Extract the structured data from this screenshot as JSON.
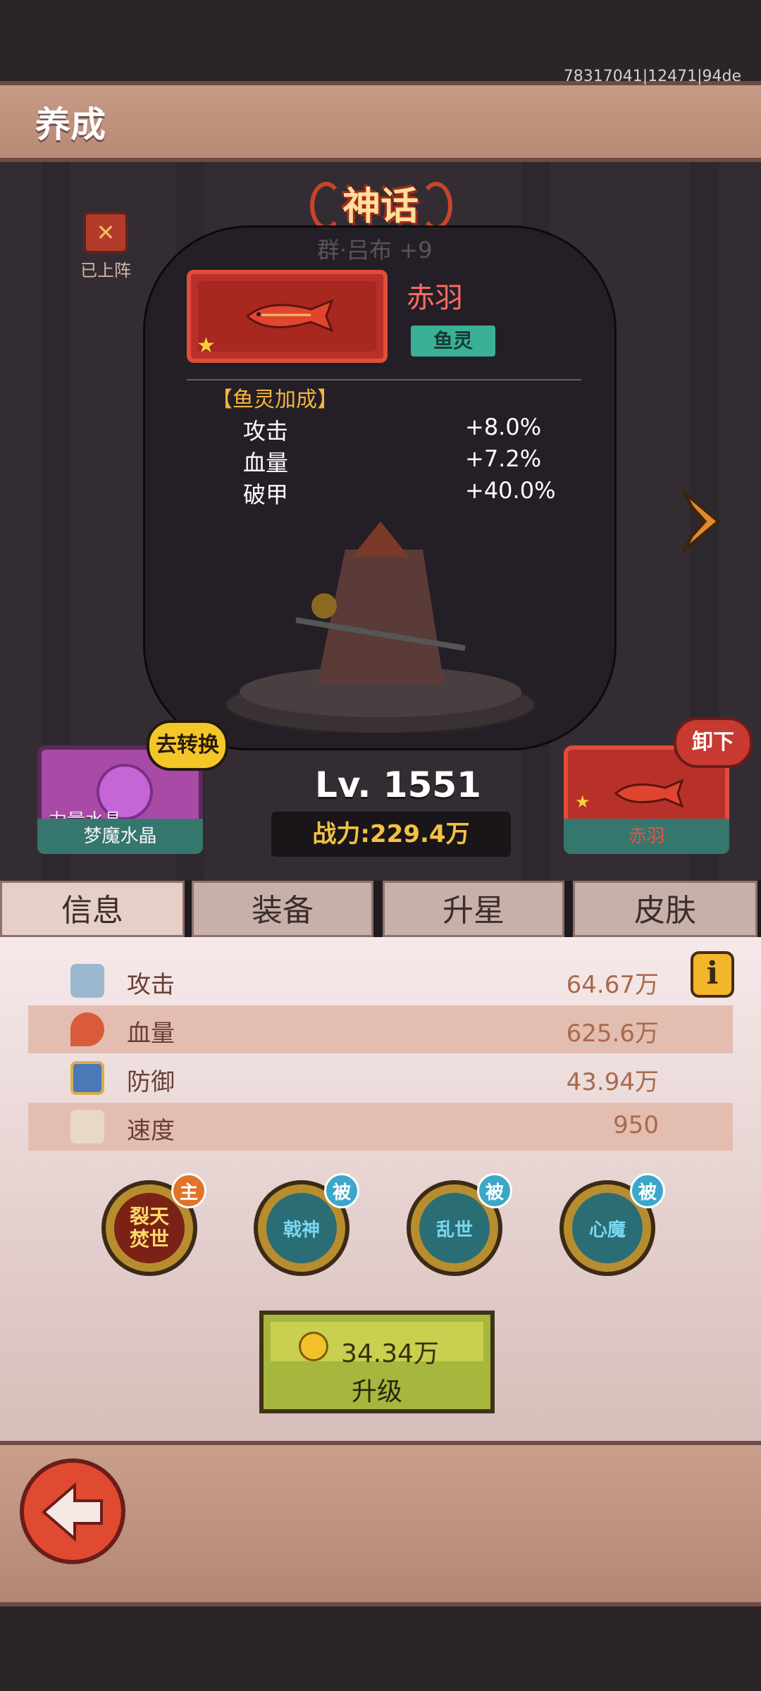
{
  "header": {
    "title": "养成",
    "build_id": "78317041|12471|94de"
  },
  "deploy": {
    "label": "已上阵",
    "icon": "crossed-swords-icon"
  },
  "hero": {
    "rarity": "神话",
    "name": "群·吕布 +9",
    "level": "Lv. 1551",
    "power": "战力:229.4万"
  },
  "pet": {
    "name": "赤羽",
    "tag": "鱼灵",
    "bonus_title": "【鱼灵加成】",
    "bonuses": [
      {
        "label": "攻击",
        "value": "+8.0%"
      },
      {
        "label": "血量",
        "value": "+7.2%"
      },
      {
        "label": "破甲",
        "value": "+40.0%"
      }
    ]
  },
  "left_card": {
    "bubble": "去转换",
    "sub_label": "力量水晶",
    "label": "梦魔水晶"
  },
  "right_card": {
    "bubble": "卸下",
    "label": "赤羽"
  },
  "tabs": [
    {
      "label": "信息"
    },
    {
      "label": "装备"
    },
    {
      "label": "升星"
    },
    {
      "label": "皮肤"
    }
  ],
  "stats": [
    {
      "label": "攻击",
      "value": "64.67万",
      "icon": "sword-icon"
    },
    {
      "label": "血量",
      "value": "625.6万",
      "icon": "blood-drop-icon"
    },
    {
      "label": "防御",
      "value": "43.94万",
      "icon": "shield-icon"
    },
    {
      "label": "速度",
      "value": "950",
      "icon": "wing-icon"
    }
  ],
  "info_button": "i",
  "skills": [
    {
      "name": "裂天焚世",
      "badge": "主"
    },
    {
      "name": "戟神",
      "badge": "被"
    },
    {
      "name": "乱世",
      "badge": "被"
    },
    {
      "name": "心魔",
      "badge": "被"
    }
  ],
  "upgrade": {
    "cost": "34.34万",
    "label": "升级"
  },
  "colors": {
    "accent_gold": "#f3c245",
    "pet_red": "#b8302a",
    "teal": "#35766d"
  }
}
